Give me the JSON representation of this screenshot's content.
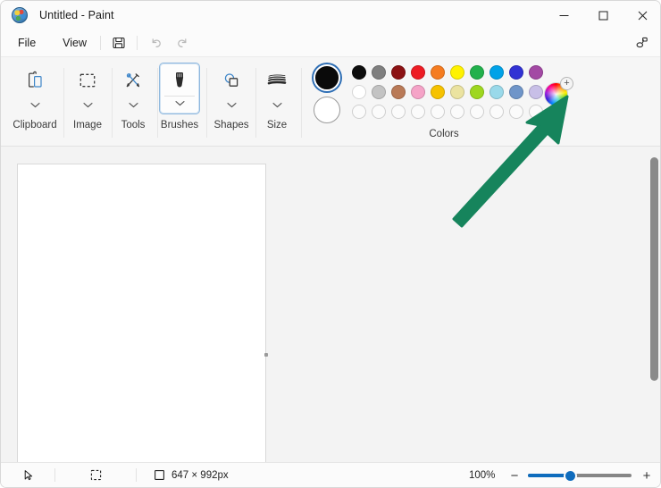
{
  "window": {
    "title": "Untitled - Paint",
    "app_icon": "paint-palette-icon",
    "minimize_glyph": "─",
    "maximize_glyph": "□",
    "close_glyph": "✕"
  },
  "menubar": {
    "items": [
      {
        "label": "File",
        "name": "menu-file"
      },
      {
        "label": "View",
        "name": "menu-view"
      }
    ],
    "save_icon": "save-floppy-icon",
    "undo_icon": "undo-arrow-icon",
    "redo_icon": "redo-arrow-icon",
    "copilot_icon": "copilot-icon"
  },
  "ribbon": {
    "groups": [
      {
        "label": "Clipboard",
        "icon": "clipboard-icon",
        "selected": false
      },
      {
        "label": "Image",
        "icon": "image-select-icon",
        "selected": false
      },
      {
        "label": "Tools",
        "icon": "tools-pencil-brush-icon",
        "selected": false
      },
      {
        "label": "Brushes",
        "icon": "brush-icon",
        "selected": true
      },
      {
        "label": "Shapes",
        "icon": "shapes-icon",
        "selected": false
      },
      {
        "label": "Size",
        "icon": "size-lines-icon",
        "selected": false
      }
    ],
    "chevron_glyph": "⌄"
  },
  "colors": {
    "label": "Colors",
    "primary": "#0a0a0a",
    "secondary": "#ffffff",
    "primary_selected": true,
    "row1": [
      "#0d0d0d",
      "#7f7f7f",
      "#8b1113",
      "#ed1c24",
      "#f57c20",
      "#fff200",
      "#22b14c",
      "#00a2e8",
      "#3132d4",
      "#a349a4"
    ],
    "row2": [
      "#ffffff",
      "#c3c3c3",
      "#b97a57",
      "#f5a3c7",
      "#f6c200",
      "#ebe3a0",
      "#9ed71f",
      "#99d9ea",
      "#6f95c9",
      "#c8bfe7"
    ],
    "row3": [
      "",
      "",
      "",
      "",
      "",
      "",
      "",
      "",
      "",
      ""
    ],
    "picker_icon": "color-wheel-add-icon",
    "picker_badge": "+"
  },
  "canvas": {
    "background": "#ffffff",
    "resize_handle": "canvas-resize-handle"
  },
  "statusbar": {
    "cursor_icon": "cursor-arrow-icon",
    "selection_icon": "selection-dashed-icon",
    "image_icon": "image-size-icon",
    "image_size": "647 × 992px",
    "zoom_level": "100%",
    "zoom_out_glyph": "−",
    "zoom_in_glyph": "+"
  },
  "annotation": {
    "arrow_color": "#16845c",
    "arrow_name": "green-pointer-arrow",
    "points_at": "color-wheel-add-icon"
  }
}
